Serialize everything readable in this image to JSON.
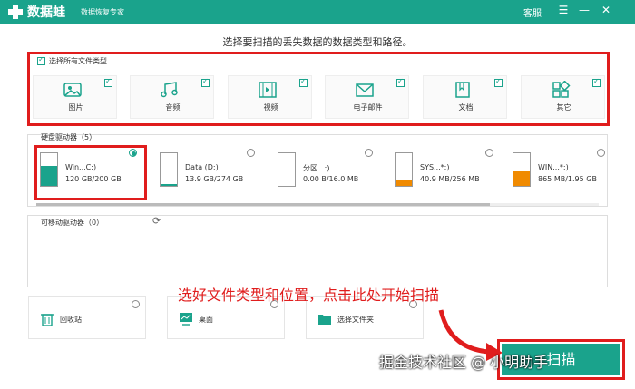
{
  "app": {
    "name": "数据蛙",
    "subtitle": "数据恢复专家",
    "service": "客服",
    "window_buttons": [
      "☰",
      "—",
      "✕"
    ],
    "accent": "#1aa38c",
    "highlight": "#e01d1d"
  },
  "instruction": "选择要扫描的丢失数据的数据类型和路径。",
  "file_types": {
    "select_all_label": "选择所有文件类型",
    "select_all_checked": true,
    "items": [
      {
        "label": "图片",
        "icon": "image-icon",
        "checked": true
      },
      {
        "label": "音频",
        "icon": "music-icon",
        "checked": true
      },
      {
        "label": "视频",
        "icon": "video-icon",
        "checked": true
      },
      {
        "label": "电子邮件",
        "icon": "email-icon",
        "checked": true
      },
      {
        "label": "文档",
        "icon": "document-icon",
        "checked": true
      },
      {
        "label": "其它",
        "icon": "other-icon",
        "checked": true
      }
    ]
  },
  "disks": {
    "title": "硬盘驱动器（5）",
    "items": [
      {
        "name": "Win...C:)",
        "size": "120 GB/200 GB",
        "fill": 0.6,
        "color": "#1aa38c",
        "selected": true
      },
      {
        "name": "Data (D:)",
        "size": "13.9 GB/274 GB",
        "fill": 0.05,
        "color": "#1aa38c",
        "selected": false
      },
      {
        "name": "分区...:)",
        "size": "0.00  B/16.0 MB",
        "fill": 0.0,
        "color": "#f08a00",
        "selected": false
      },
      {
        "name": "SYS...*:)",
        "size": "40.9 MB/256 MB",
        "fill": 0.16,
        "color": "#f08a00",
        "selected": false
      },
      {
        "name": "WIN...*:)",
        "size": "865 MB/1.95 GB",
        "fill": 0.44,
        "color": "#f08a00",
        "selected": false
      }
    ]
  },
  "removable": {
    "title": "可移动驱动器（0）"
  },
  "locations": [
    {
      "label": "回收站",
      "icon": "recycle-bin-icon"
    },
    {
      "label": "桌面",
      "icon": "desktop-icon"
    },
    {
      "label": "选择文件夹",
      "icon": "folder-icon"
    }
  ],
  "hint": "选好文件类型和位置，点击此处开始扫描",
  "watermark": "掘金技术社区 @ 小明助手",
  "scan_button": "扫描"
}
